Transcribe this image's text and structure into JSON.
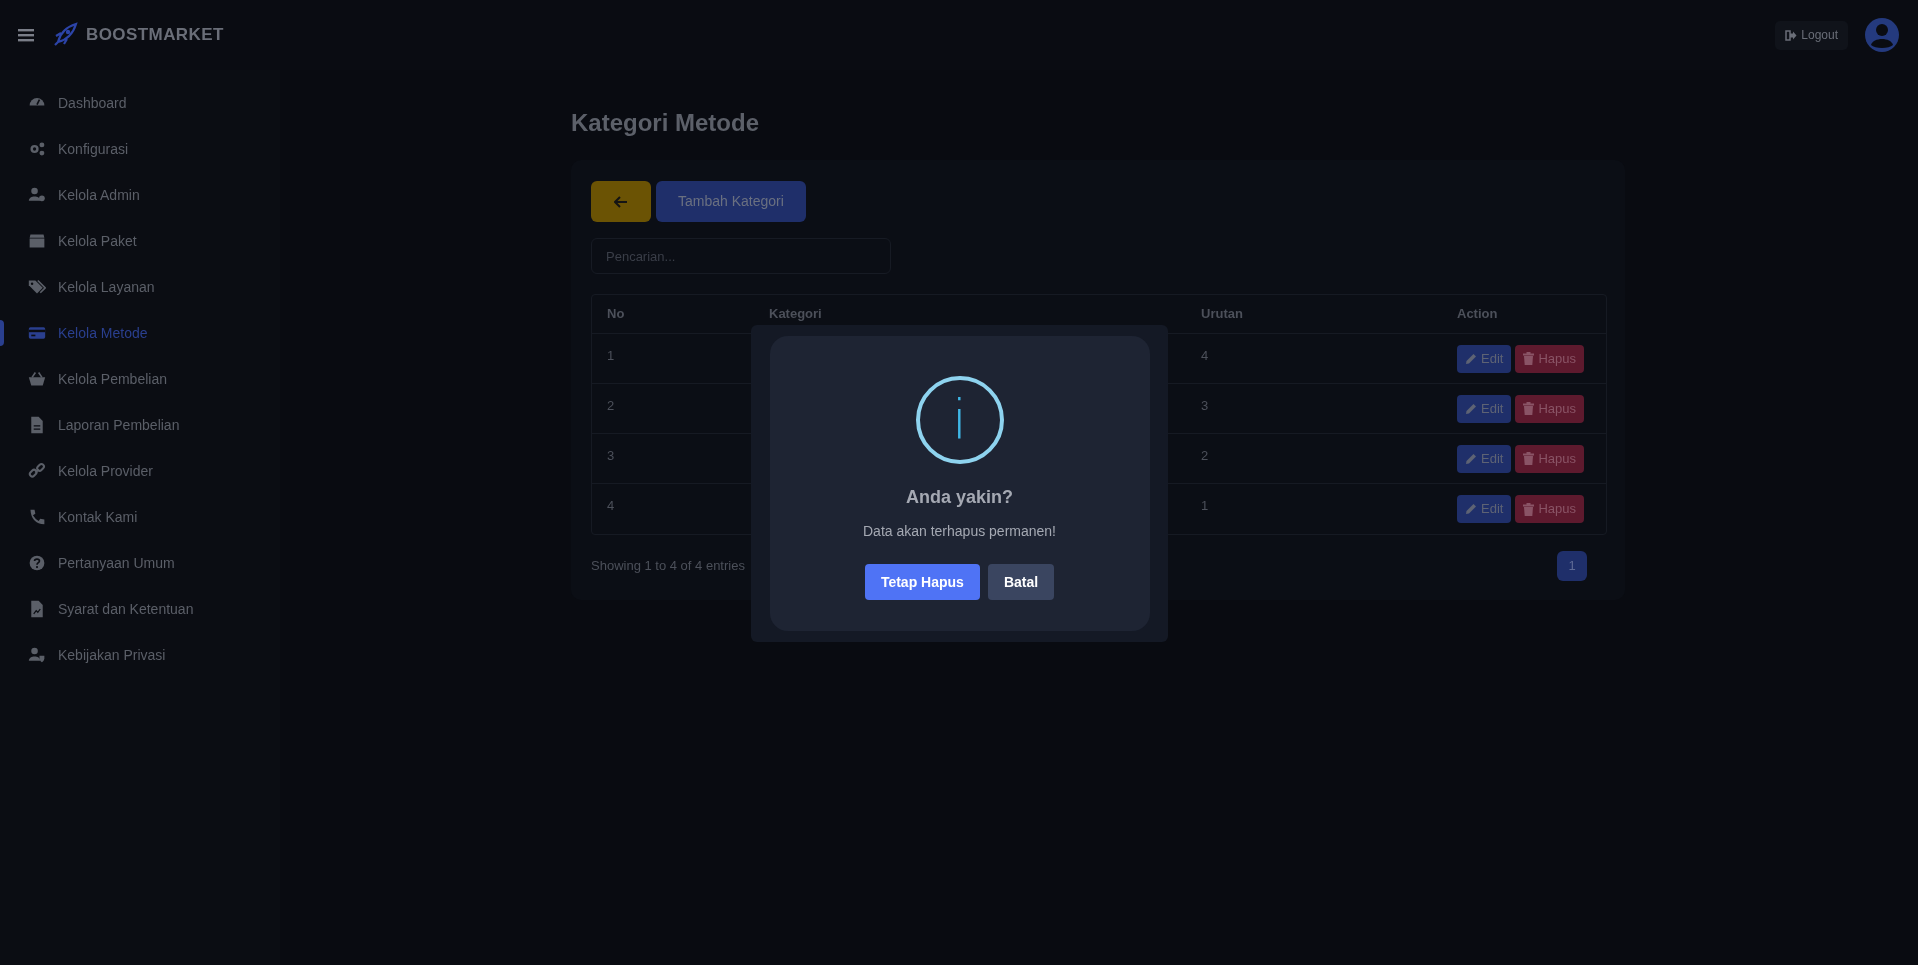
{
  "header": {
    "brand": "BOOSTMARKET",
    "logout": "Logout"
  },
  "sidebar": {
    "items": [
      {
        "label": "Dashboard",
        "selected": false
      },
      {
        "label": "Konfigurasi",
        "selected": false
      },
      {
        "label": "Kelola Admin",
        "selected": false
      },
      {
        "label": "Kelola Paket",
        "selected": false
      },
      {
        "label": "Kelola Layanan",
        "selected": false
      },
      {
        "label": "Kelola Metode",
        "selected": true
      },
      {
        "label": "Kelola Pembelian",
        "selected": false
      },
      {
        "label": "Laporan Pembelian",
        "selected": false
      },
      {
        "label": "Kelola Provider",
        "selected": false
      },
      {
        "label": "Kontak Kami",
        "selected": false
      },
      {
        "label": "Pertanyaan Umum",
        "selected": false
      },
      {
        "label": "Syarat dan Ketentuan",
        "selected": false
      },
      {
        "label": "Kebijakan Privasi",
        "selected": false
      }
    ]
  },
  "page_title": "Kategori Metode",
  "toolbar": {
    "add_button": "Tambah Kategori"
  },
  "search": {
    "placeholder": "Pencarian..."
  },
  "table": {
    "columns": [
      "No",
      "Kategori",
      "Urutan",
      "Action"
    ],
    "rows": [
      {
        "no": "1",
        "urutan": "4",
        "actions": [
          "Edit",
          "Hapus"
        ]
      },
      {
        "no": "2",
        "urutan": "3",
        "actions": [
          "Edit",
          "Hapus"
        ]
      },
      {
        "no": "3",
        "urutan": "2",
        "actions": [
          "Edit",
          "Hapus"
        ]
      },
      {
        "no": "4",
        "urutan": "1",
        "actions": [
          "Edit",
          "Hapus"
        ]
      }
    ]
  },
  "footer": {
    "info": "Showing 1 to 4 of 4 entries",
    "pages": [
      {
        "label": "1",
        "selected": true
      }
    ]
  },
  "dialog": {
    "icon": "i",
    "title": "Anda yakin?",
    "message": "Data akan terhapus permanen!",
    "buttons": [
      {
        "label": "Tetap Hapus",
        "kind": "confirm"
      },
      {
        "label": "Batal",
        "kind": "cancel"
      }
    ]
  }
}
